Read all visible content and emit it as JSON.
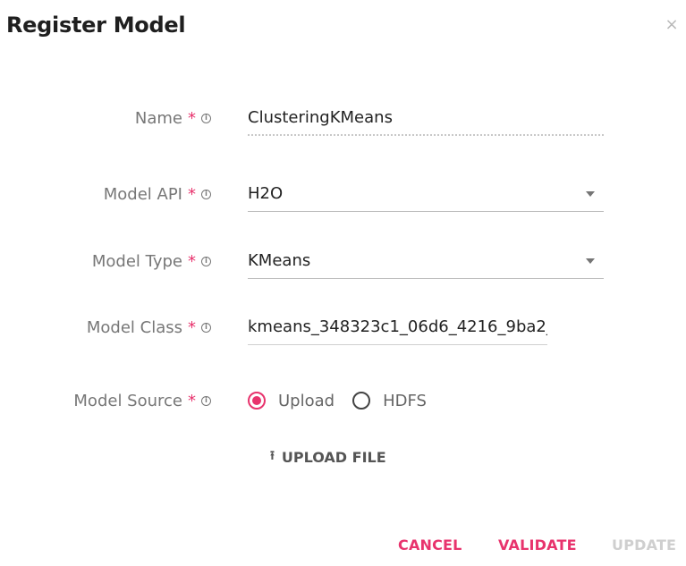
{
  "dialog": {
    "title": "Register Model",
    "close_icon": "×"
  },
  "form": {
    "name": {
      "label": "Name",
      "required": "*",
      "info": "i",
      "value": "ClusteringKMeans"
    },
    "model_api": {
      "label": "Model API",
      "required": "*",
      "info": "i",
      "value": "H2O"
    },
    "model_type": {
      "label": "Model Type",
      "required": "*",
      "info": "i",
      "value": "KMeans"
    },
    "model_class": {
      "label": "Model Class",
      "required": "*",
      "info": "i",
      "value": "kmeans_348323c1_06d6_4216_9ba2_"
    },
    "model_source": {
      "label": "Model Source",
      "required": "*",
      "info": "i",
      "options": [
        "Upload",
        "HDFS"
      ],
      "selected": "Upload"
    },
    "upload_button": {
      "icon": "⭱",
      "label": "UPLOAD FILE"
    }
  },
  "actions": {
    "cancel": "CANCEL",
    "validate": "VALIDATE",
    "update": "UPDATE"
  },
  "colors": {
    "accent": "#e8336d",
    "disabled": "#cfcfcf",
    "label": "#777777"
  }
}
